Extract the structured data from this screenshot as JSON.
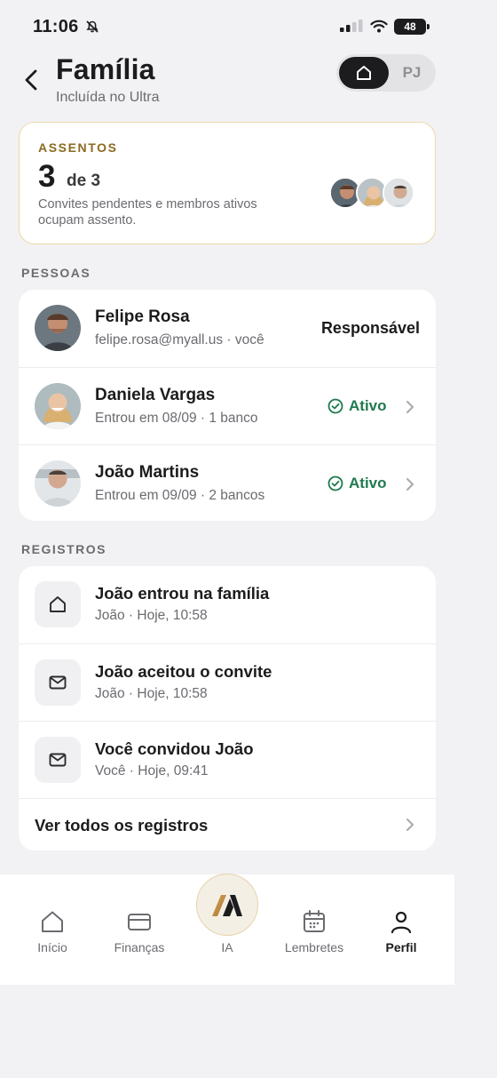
{
  "status_bar": {
    "time": "11:06",
    "battery": "48",
    "bell_icon": "bell-slash-icon",
    "signal_icon": "signal-icon",
    "wifi_icon": "wifi-icon"
  },
  "header": {
    "title": "Família",
    "subtitle": "Incluída no Ultra",
    "back_icon": "chevron-left-icon",
    "segment": {
      "home_icon": "house-icon",
      "pj_label": "PJ",
      "selected": "home"
    }
  },
  "seats": {
    "label": "ASSENTOS",
    "used": "3",
    "of_total": "de 3",
    "description": "Convites pendentes e membros ativos ocupam assento."
  },
  "people": {
    "section_label": "PESSOAS",
    "items": [
      {
        "name": "Felipe Rosa",
        "detail": "felipe.rosa@myall.us · você",
        "role": "Responsável",
        "avatar_color": "#a9745a"
      },
      {
        "name": "Daniela Vargas",
        "detail": "Entrou em 08/09 · 1 banco",
        "status": "Ativo",
        "avatar_color": "#d8b27a"
      },
      {
        "name": "João Martins",
        "detail": "Entrou em 09/09 · 2 bancos",
        "status": "Ativo",
        "avatar_color": "#c7b3a6"
      }
    ]
  },
  "records": {
    "section_label": "REGISTROS",
    "items": [
      {
        "icon": "house-icon",
        "title": "João entrou na família",
        "detail": "João · Hoje, 10:58"
      },
      {
        "icon": "envelope-icon",
        "title": "João aceitou o convite",
        "detail": "João · Hoje, 10:58"
      },
      {
        "icon": "envelope-icon",
        "title": "Você convidou João",
        "detail": "Você · Hoje, 09:41"
      }
    ],
    "see_all": "Ver todos os registros"
  },
  "tabbar": {
    "tabs": [
      {
        "label": "Início",
        "icon": "house-icon"
      },
      {
        "label": "Finanças",
        "icon": "credit-card-icon"
      },
      {
        "label": "IA",
        "icon": "ia-logo-icon"
      },
      {
        "label": "Lembretes",
        "icon": "calendar-icon"
      },
      {
        "label": "Perfil",
        "icon": "person-icon"
      }
    ],
    "active": "Perfil"
  },
  "colors": {
    "accent_gold": "#8a6b1f",
    "status_green": "#1f7a4e",
    "dark": "#1c1c1e"
  }
}
